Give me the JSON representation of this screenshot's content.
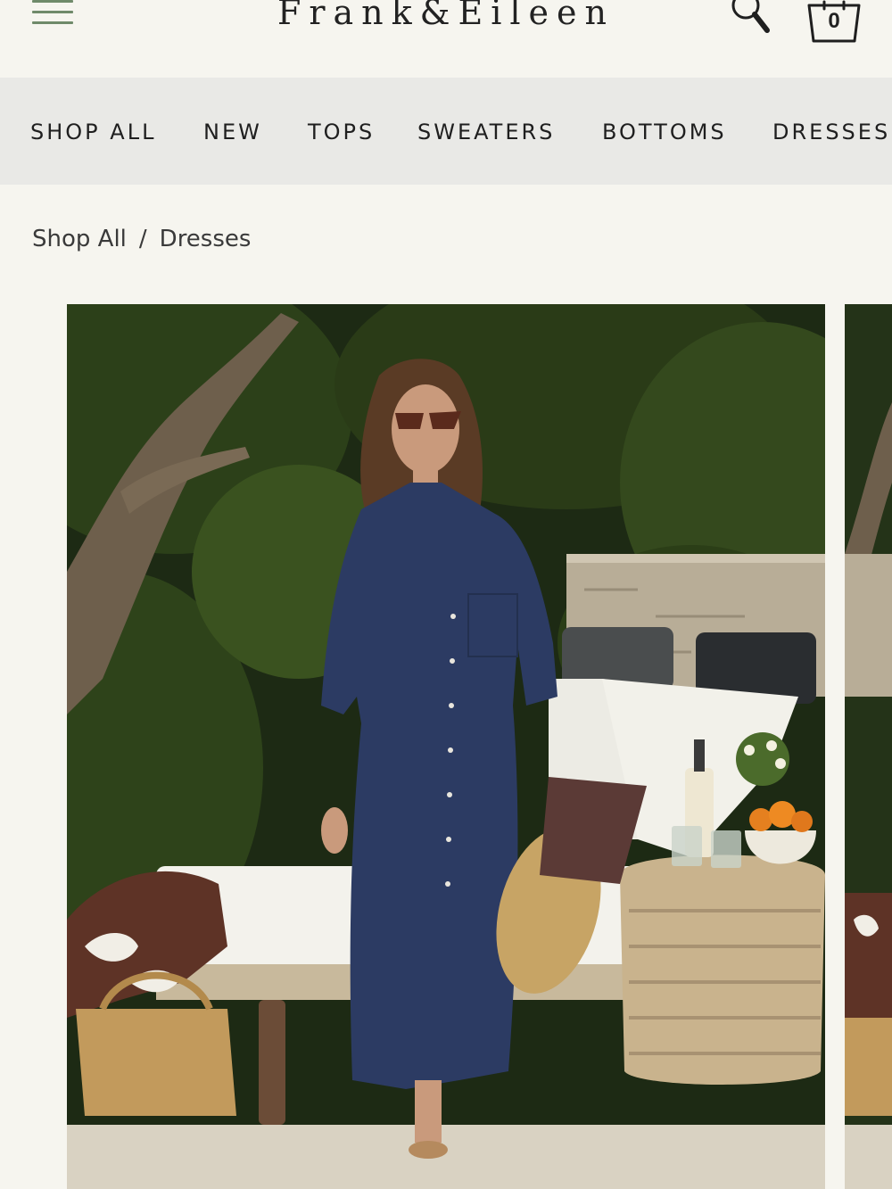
{
  "header": {
    "logo": "Frank&Eileen",
    "cart_count": "0"
  },
  "nav": {
    "items": [
      "SHOP ALL",
      "NEW",
      "TOPS",
      "SWEATERS",
      "BOTTOMS",
      "DRESSES"
    ]
  },
  "breadcrumb": {
    "items": [
      "Shop All",
      "Dresses"
    ],
    "separator": "/"
  },
  "product": {
    "image_subject": "Woman in navy linen long shirt dress walking by poolside lounge chairs"
  },
  "colors": {
    "page_bg": "#f6f5ef",
    "nav_bg": "#e9e9e6",
    "menu_icon": "#6f8a6a",
    "dress_navy": "#2c3b63"
  },
  "icons": {
    "menu": "hamburger-menu-icon",
    "search": "search-icon",
    "cart": "shopping-bag-icon"
  }
}
